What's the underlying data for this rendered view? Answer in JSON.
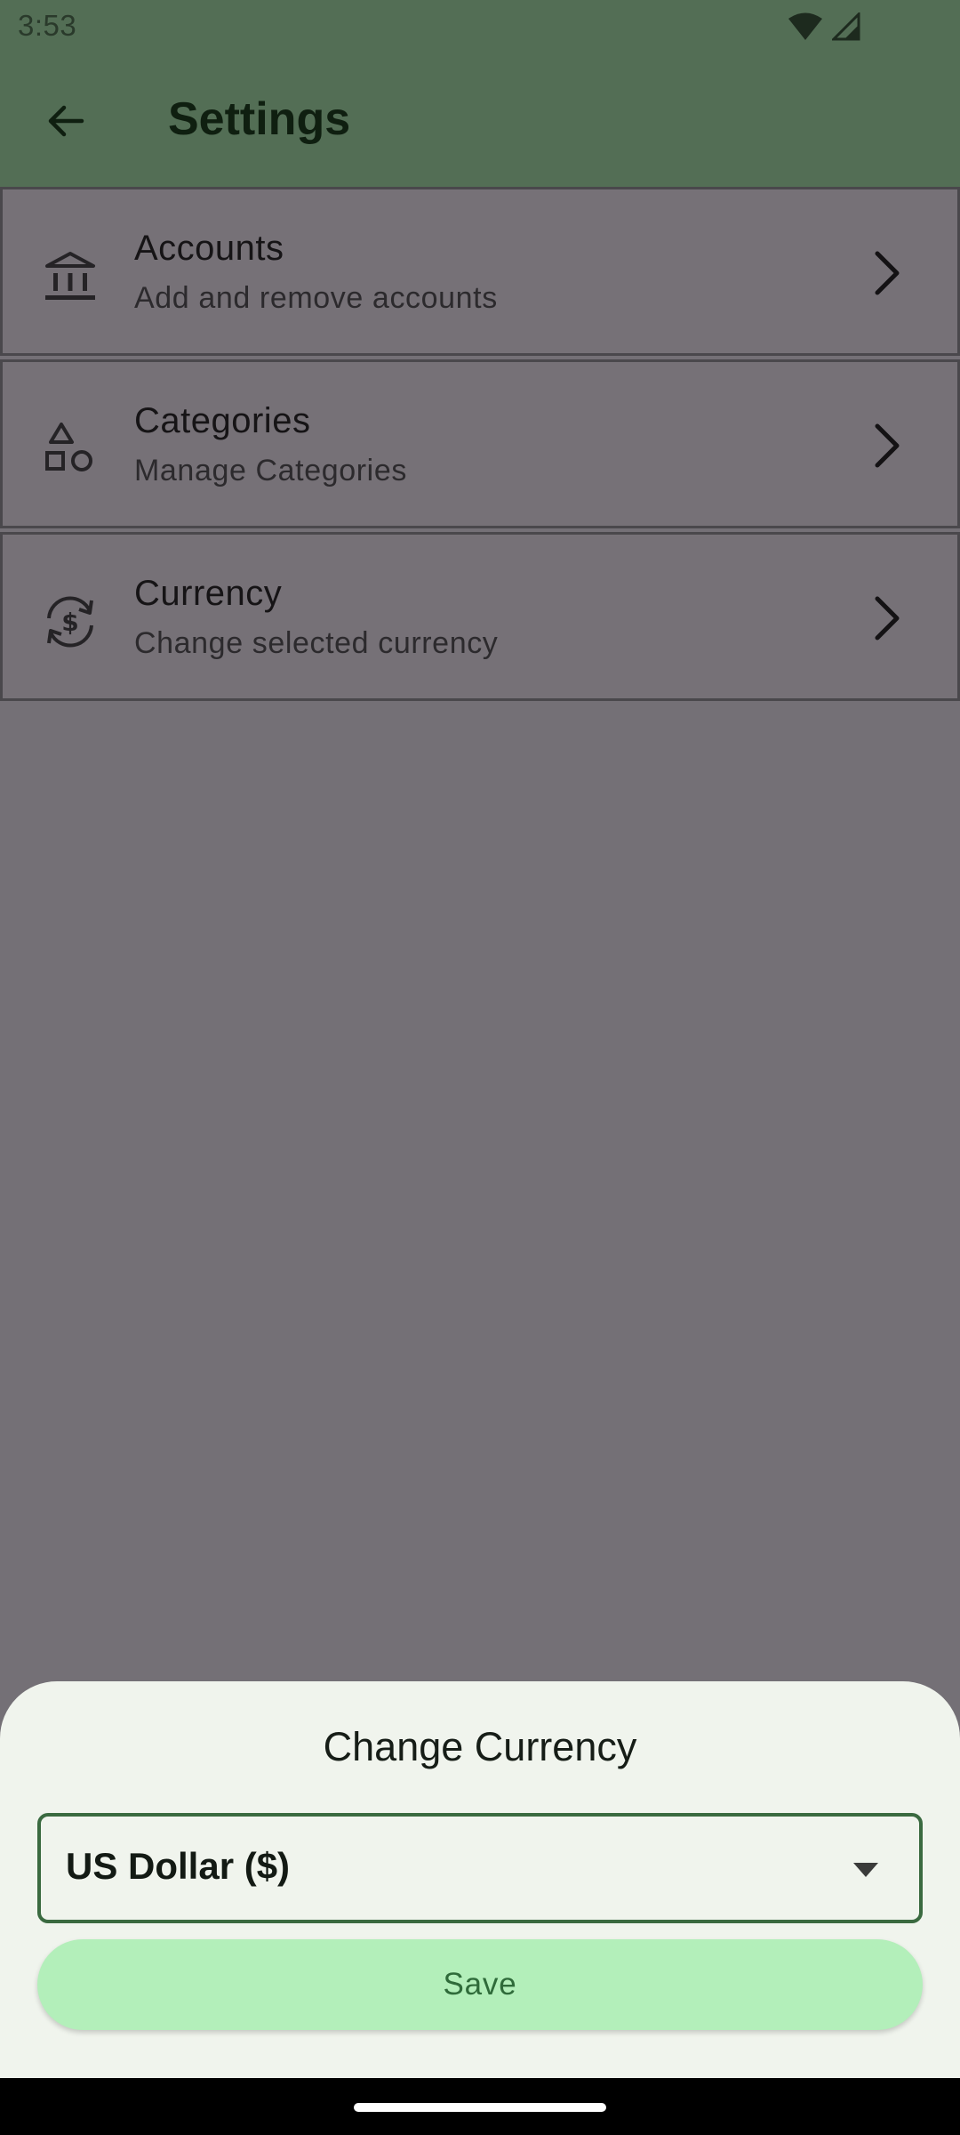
{
  "status_bar": {
    "time": "3:53"
  },
  "app_bar": {
    "title": "Settings"
  },
  "settings": {
    "items": [
      {
        "title": "Accounts",
        "subtitle": "Add and remove accounts",
        "icon": "bank-icon"
      },
      {
        "title": "Categories",
        "subtitle": "Manage Categories",
        "icon": "shapes-icon"
      },
      {
        "title": "Currency",
        "subtitle": "Change selected currency",
        "icon": "currency-exchange-icon"
      }
    ]
  },
  "sheet": {
    "title": "Change Currency",
    "selected_currency": "US Dollar ($)",
    "save_label": "Save"
  },
  "colors": {
    "app_bar": "#536e55",
    "scrim": "#747076",
    "sheet_background": "#f0f4ed",
    "select_border": "#3a6a40",
    "save_button": "#b3efba",
    "save_text": "#2f6b3a"
  }
}
